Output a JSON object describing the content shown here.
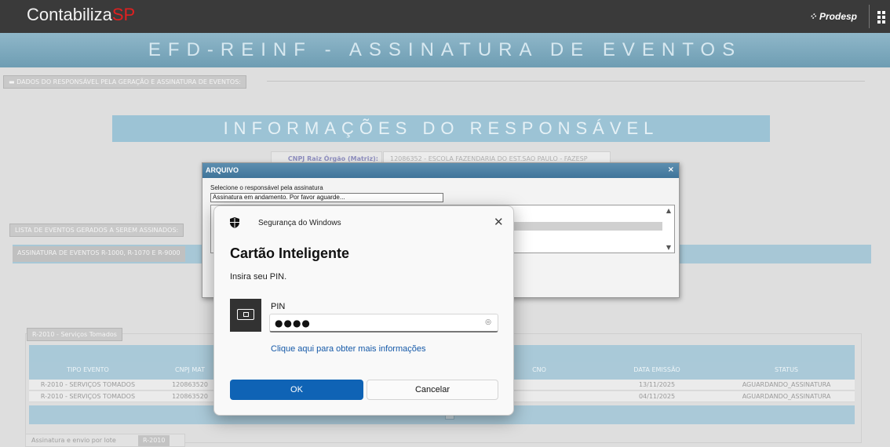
{
  "header": {
    "logo_main": "Contabiliza",
    "logo_accent": "SP",
    "partner": "Prodesp"
  },
  "banner": {
    "title": "EFD-REINF - ASSINATURA DE EVENTOS"
  },
  "responsavel_section": {
    "legend": "DADOS DO RESPONSÁVEL PELA GERAÇÃO E ASSINATURA DE EVENTOS:"
  },
  "info": {
    "title": "INFORMAÇÕES DO RESPONSÁVEL",
    "cnpj_label": "CNPJ Raiz Órgão (Matriz):",
    "cnpj_value": "12086352 - ESCOLA FAZENDARIA DO EST.SAO PAULO - FAZESP"
  },
  "eventos_section": {
    "legend": "LISTA DE EVENTOS GERADOS A SEREM ASSINADOS:"
  },
  "assinatura_tab": "ASSINATURA DE EVENTOS R-1000, R-1070 E R-9000",
  "r2010": {
    "legend": "R-2010 - Serviços Tomados",
    "columns": [
      "TIPO EVENTO",
      "CNPJ MAT",
      "CNO",
      "DATA EMISSÃO",
      "STATUS"
    ],
    "rows": [
      {
        "tipo": "R-2010 - SERVIÇOS TOMADOS",
        "cnpj": "120863520",
        "data": "13/11/2025",
        "status": "AGUARDANDO_ASSINATURA"
      },
      {
        "tipo": "R-2010 - SERVIÇOS TOMADOS",
        "cnpj": "120863520",
        "data": "04/11/2025",
        "status": "AGUARDANDO_ASSINATURA"
      }
    ]
  },
  "lote": {
    "label": "Assinatura e envio por lote",
    "button": "R-2010"
  },
  "arquivo_dialog": {
    "title": "ARQUIVO",
    "close": "×",
    "label": "Selecione o responsável pela assinatura",
    "status": "Assinatura em andamento. Por favor aguarde..."
  },
  "windows_security": {
    "app_name": "Segurança do Windows",
    "close": "✕",
    "title": "Cartão Inteligente",
    "subtitle": "Insira seu PIN.",
    "pin_label": "PIN",
    "pin_value": "●●●●",
    "link": "Clique aqui para obter mais informações",
    "ok_label": "OK",
    "cancel_label": "Cancelar"
  }
}
